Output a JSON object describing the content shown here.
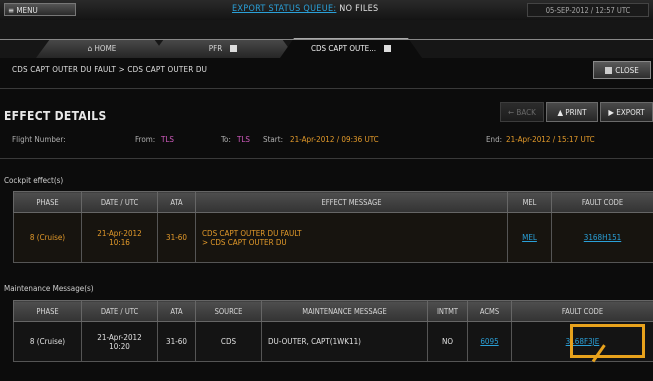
{
  "topbar": {
    "menu_label": "≡ MENU",
    "export_link": "EXPORT STATUS QUEUE:",
    "export_status": " NO FILES",
    "datetime": "05-SEP-2012 / 12:57 UTC"
  },
  "tabs": [
    {
      "label": "⌂ HOME"
    },
    {
      "label": "PFR"
    },
    {
      "label": "CDS CAPT OUTE..."
    }
  ],
  "breadcrumb": "CDS CAPT OUTER DU FAULT > CDS CAPT OUTER DU",
  "close_label": "CLOSE",
  "effect_title": "EFFECT DETAILS",
  "toolbar": {
    "back_label": "← BACK",
    "print_label": "PRINT",
    "export_label": "EXPORT"
  },
  "flight": {
    "number_label": "Flight Number:",
    "from_label": "From:",
    "from_value": "TLS",
    "to_label": "To:",
    "to_value": "TLS",
    "start_label": "Start:",
    "start_value": "21-Apr-2012 / 09:36 UTC",
    "end_label": "End:",
    "end_value": "21-Apr-2012 / 15:17 UTC"
  },
  "cockpit": {
    "section_label": "Cockpit effect(s)",
    "headers": [
      "PHASE",
      "DATE / UTC",
      "ATA",
      "EFFECT MESSAGE",
      "MEL",
      "FAULT CODE"
    ],
    "row": {
      "phase": "8 (Cruise)",
      "date": "21-Apr-2012",
      "time": "10:16",
      "ata": "31-60",
      "msg1": "CDS CAPT OUTER DU FAULT",
      "msg2": "> CDS CAPT OUTER DU",
      "mel": "MEL",
      "fault": "3168H151"
    }
  },
  "maintenance": {
    "section_label": "Maintenance Message(s)",
    "headers": [
      "PHASE",
      "DATE / UTC",
      "ATA",
      "SOURCE",
      "MAINTENANCE MESSAGE",
      "INTMT",
      "ACMS",
      "FAULT CODE"
    ],
    "row": {
      "phase": "8 (Cruise)",
      "date": "21-Apr-2012",
      "time": "10:20",
      "ata": "31-60",
      "source": "CDS",
      "msg": "DU-OUTER, CAPT(1WK11)",
      "intmt": "NO",
      "acms": "6095",
      "fault": "3168F3JE"
    }
  },
  "colors": {
    "accent_orange": "#e39a2a",
    "link_blue": "#2aa0d8",
    "highlight": "#e8a21c",
    "location_magenta": "#d25bbf"
  }
}
